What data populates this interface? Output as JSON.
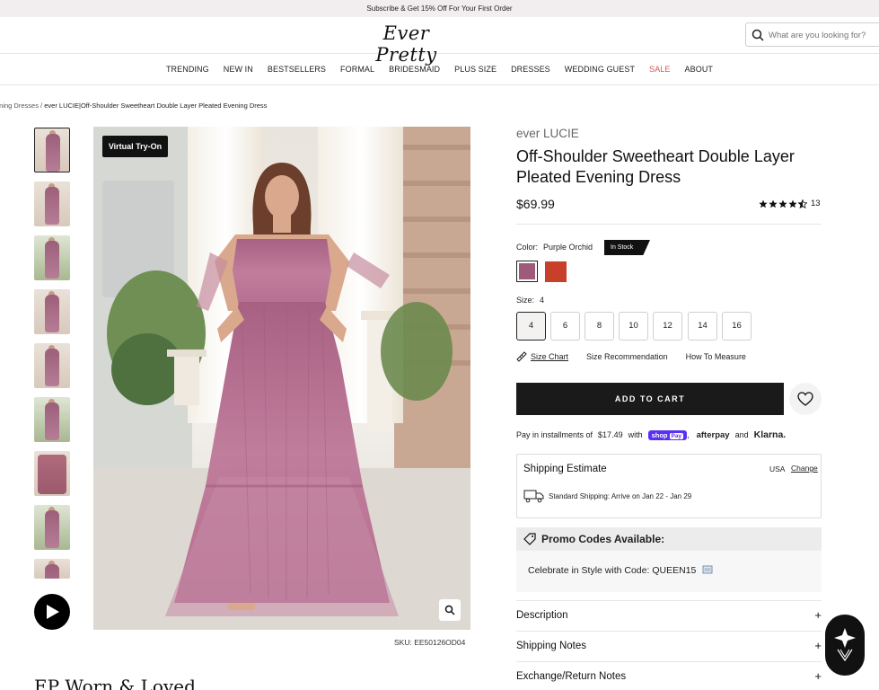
{
  "promo_bar": {
    "text": "Subscribe & Get 15% Off For Your First Order"
  },
  "header": {
    "logo": "Ever Pretty",
    "search_placeholder": "What are you looking for?"
  },
  "nav": {
    "items": [
      "TRENDING",
      "NEW IN",
      "BESTSELLERS",
      "FORMAL",
      "BRIDESMAID",
      "PLUS SIZE",
      "DRESSES",
      "WEDDING GUEST",
      "SALE",
      "ABOUT"
    ]
  },
  "breadcrumb": {
    "parent": "ening Dresses",
    "separator": "/",
    "current": "ever LUCIE|Off-Shoulder Sweetheart Double Layer Pleated Evening Dress"
  },
  "gallery": {
    "badge": "Virtual Try-On",
    "sku": "SKU: EE50126OD04"
  },
  "product": {
    "brand": "ever LUCIE",
    "title": "Off-Shoulder Sweetheart Double Layer Pleated Evening Dress",
    "price": "$69.99",
    "rating": 4.5,
    "review_count": "13",
    "color_label": "Color:",
    "color_value": "Purple Orchid",
    "stock": "In Stock",
    "swatches": [
      "#a05a78",
      "#c8402a"
    ],
    "size_label": "Size:",
    "size_value": "4",
    "sizes": [
      "4",
      "6",
      "8",
      "10",
      "12",
      "14",
      "16"
    ],
    "size_chart": "Size Chart",
    "size_recommendation": "Size Recommendation",
    "how_to_measure": "How To Measure",
    "add_to_cart": "ADD TO CART"
  },
  "installments": {
    "prefix": "Pay in installments of",
    "amount": "$17.49",
    "with": "with",
    "shop": "shop",
    "pay": "Pay",
    "comma": ",",
    "afterpay": "afterpay",
    "and": "and",
    "klarna": "Klarna."
  },
  "shipping": {
    "title": "Shipping Estimate",
    "country": "USA",
    "change": "Change",
    "line": "Standard Shipping: Arrive on Jan 22 - Jan 29"
  },
  "promo": {
    "title": "Promo Codes Available:",
    "body": "Celebrate in Style with Code: QUEEN15"
  },
  "accordions": [
    "Description",
    "Shipping Notes",
    "Exchange/Return Notes"
  ],
  "section": {
    "worn_title": "EP Worn & Loved"
  },
  "colors": {
    "sale": "#d9534f",
    "accent_dark": "#1a1a1a",
    "shoppay": "#5a31f4"
  }
}
